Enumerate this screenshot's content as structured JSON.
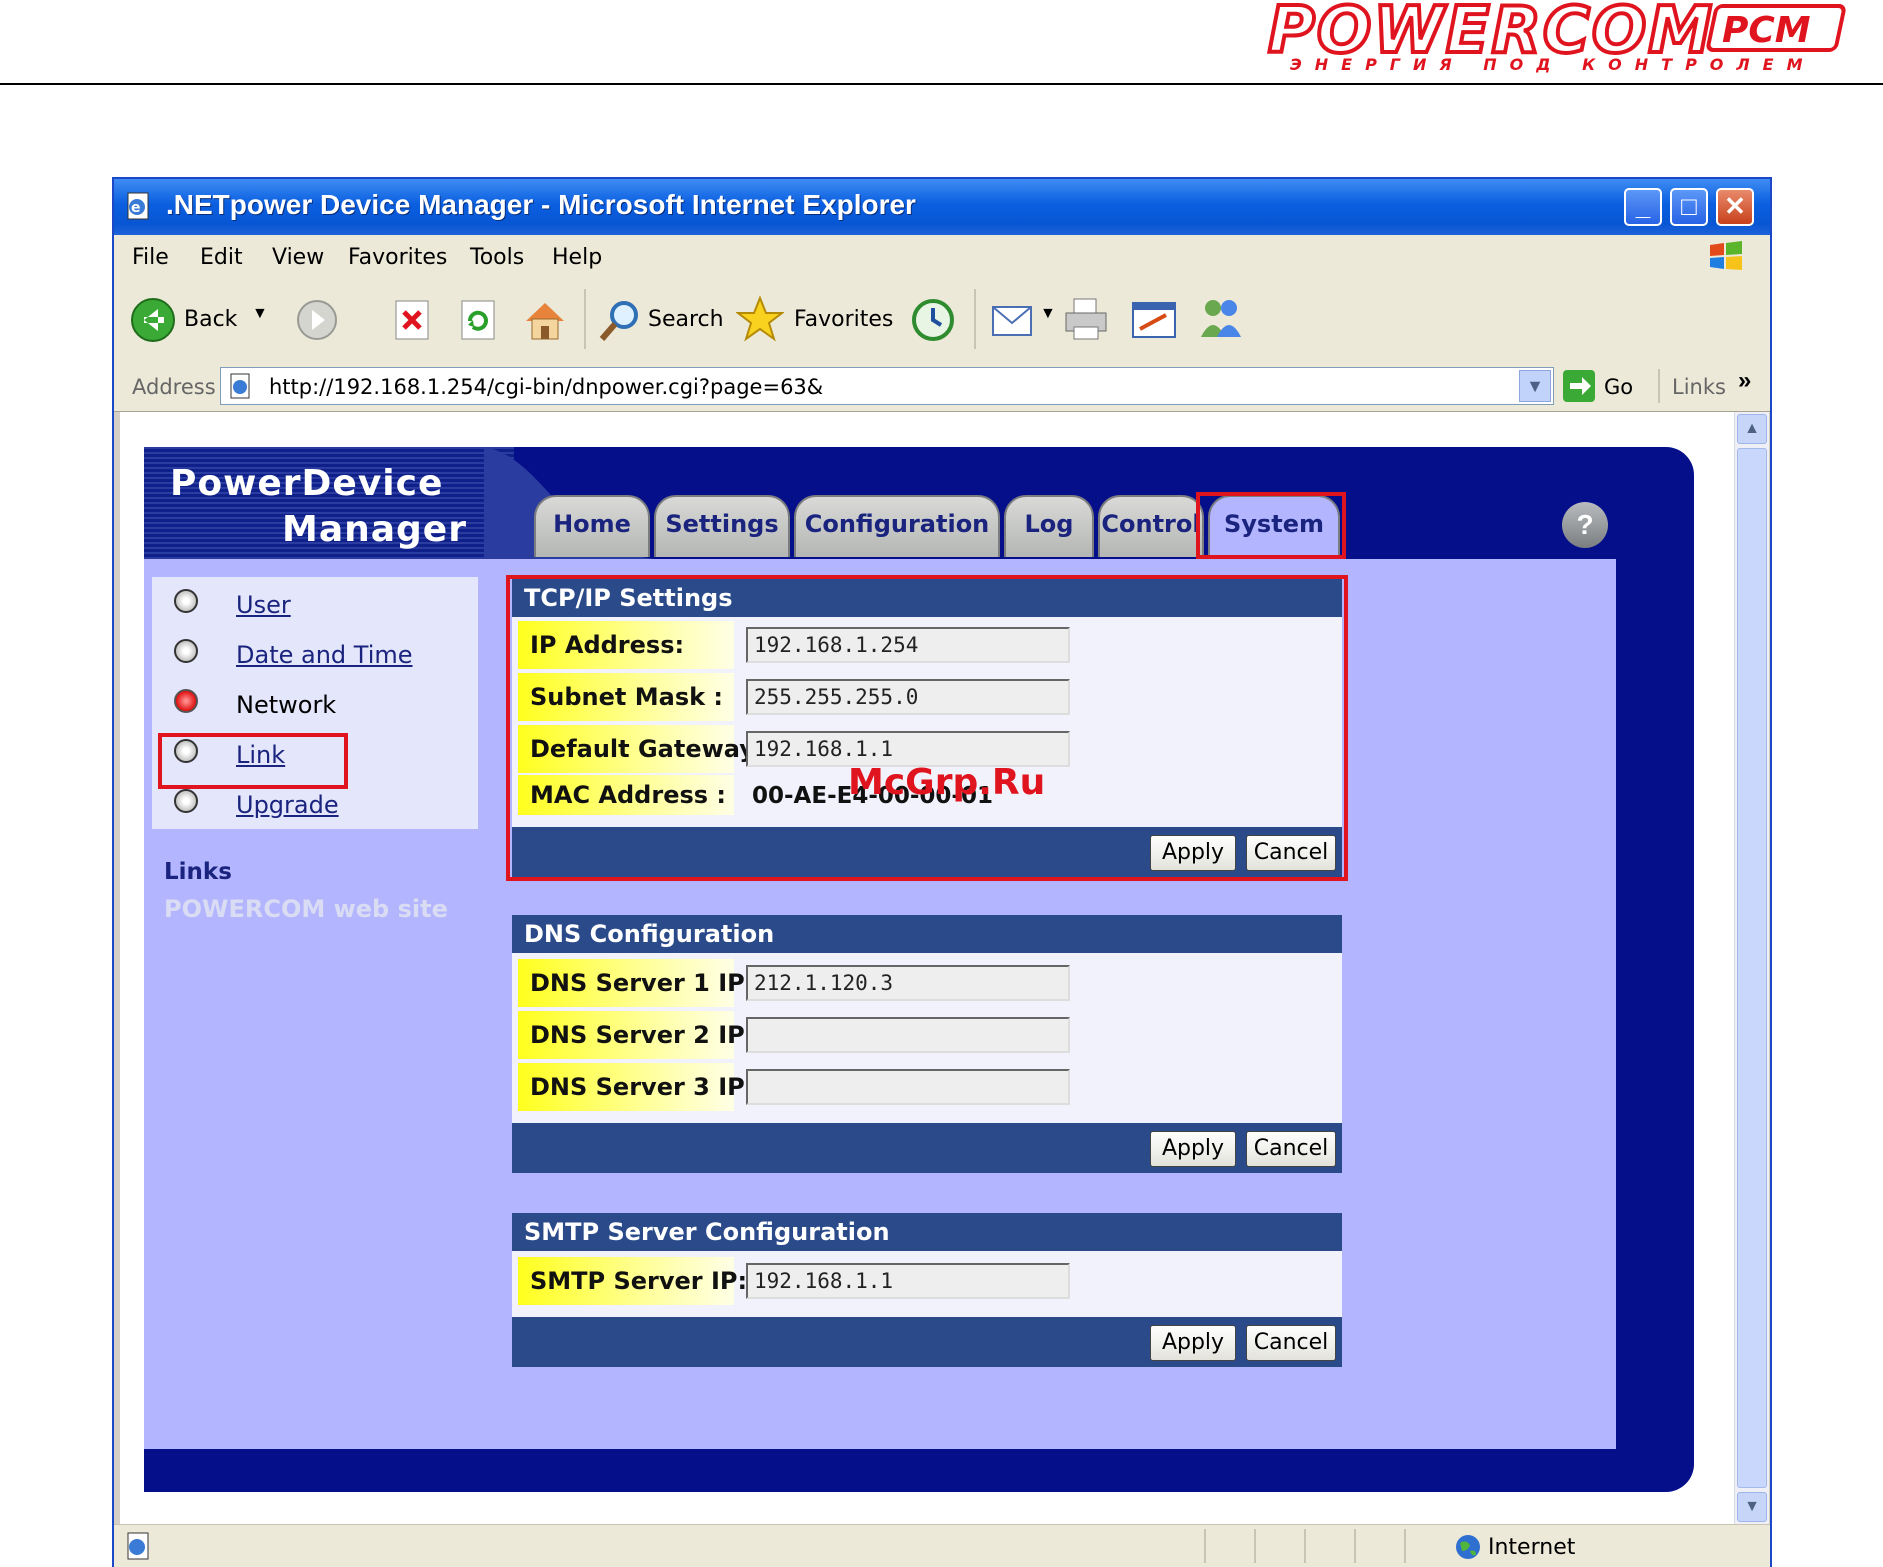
{
  "brand": {
    "name": "POWERCOM",
    "tagline": "ЭНЕРГИЯ ПОД КОНТРОЛЕМ",
    "color": "#e0141e"
  },
  "window": {
    "title": ".NETpower Device Manager - Microsoft Internet Explorer"
  },
  "menubar": [
    "File",
    "Edit",
    "View",
    "Favorites",
    "Tools",
    "Help"
  ],
  "toolbar": {
    "back": "Back",
    "search": "Search",
    "favorites": "Favorites"
  },
  "address": {
    "label": "Address",
    "url": "http://192.168.1.254/cgi-bin/dnpower.cgi?page=63&",
    "go": "Go",
    "links": "Links"
  },
  "status": {
    "zone": "Internet"
  },
  "app": {
    "logo_line1": "PowerDevice",
    "logo_line2": "Manager",
    "tabs": [
      "Home",
      "Settings",
      "Configuration",
      "Log",
      "Control",
      "System"
    ],
    "active_tab": "System",
    "help": "?",
    "side_menu": [
      "User",
      "Date and Time",
      "Network",
      "Link",
      "Upgrade"
    ],
    "side_current": "Network",
    "links_heading": "Links",
    "links_site": "POWERCOM web site"
  },
  "tcpip": {
    "title": "TCP/IP Settings",
    "ip_label": "IP Address:",
    "ip": "192.168.1.254",
    "mask_label": "Subnet Mask :",
    "mask": "255.255.255.0",
    "gw_label": "Default Gateway :",
    "gw": "192.168.1.1",
    "mac_label": "MAC Address :",
    "mac": "00-AE-E4-00-00-01",
    "apply": "Apply",
    "cancel": "Cancel"
  },
  "dns": {
    "title": "DNS Configuration",
    "dns1_label": "DNS Server 1 IP:",
    "dns1": "212.1.120.3",
    "dns2_label": "DNS Server 2 IP:",
    "dns2": "",
    "dns3_label": "DNS Server 3 IP:",
    "dns3": "",
    "apply": "Apply",
    "cancel": "Cancel"
  },
  "smtp": {
    "title": "SMTP Server Configuration",
    "ip_label": "SMTP Server IP:",
    "ip": "192.168.1.1",
    "apply": "Apply",
    "cancel": "Cancel"
  },
  "watermark": "McGrp.Ru"
}
